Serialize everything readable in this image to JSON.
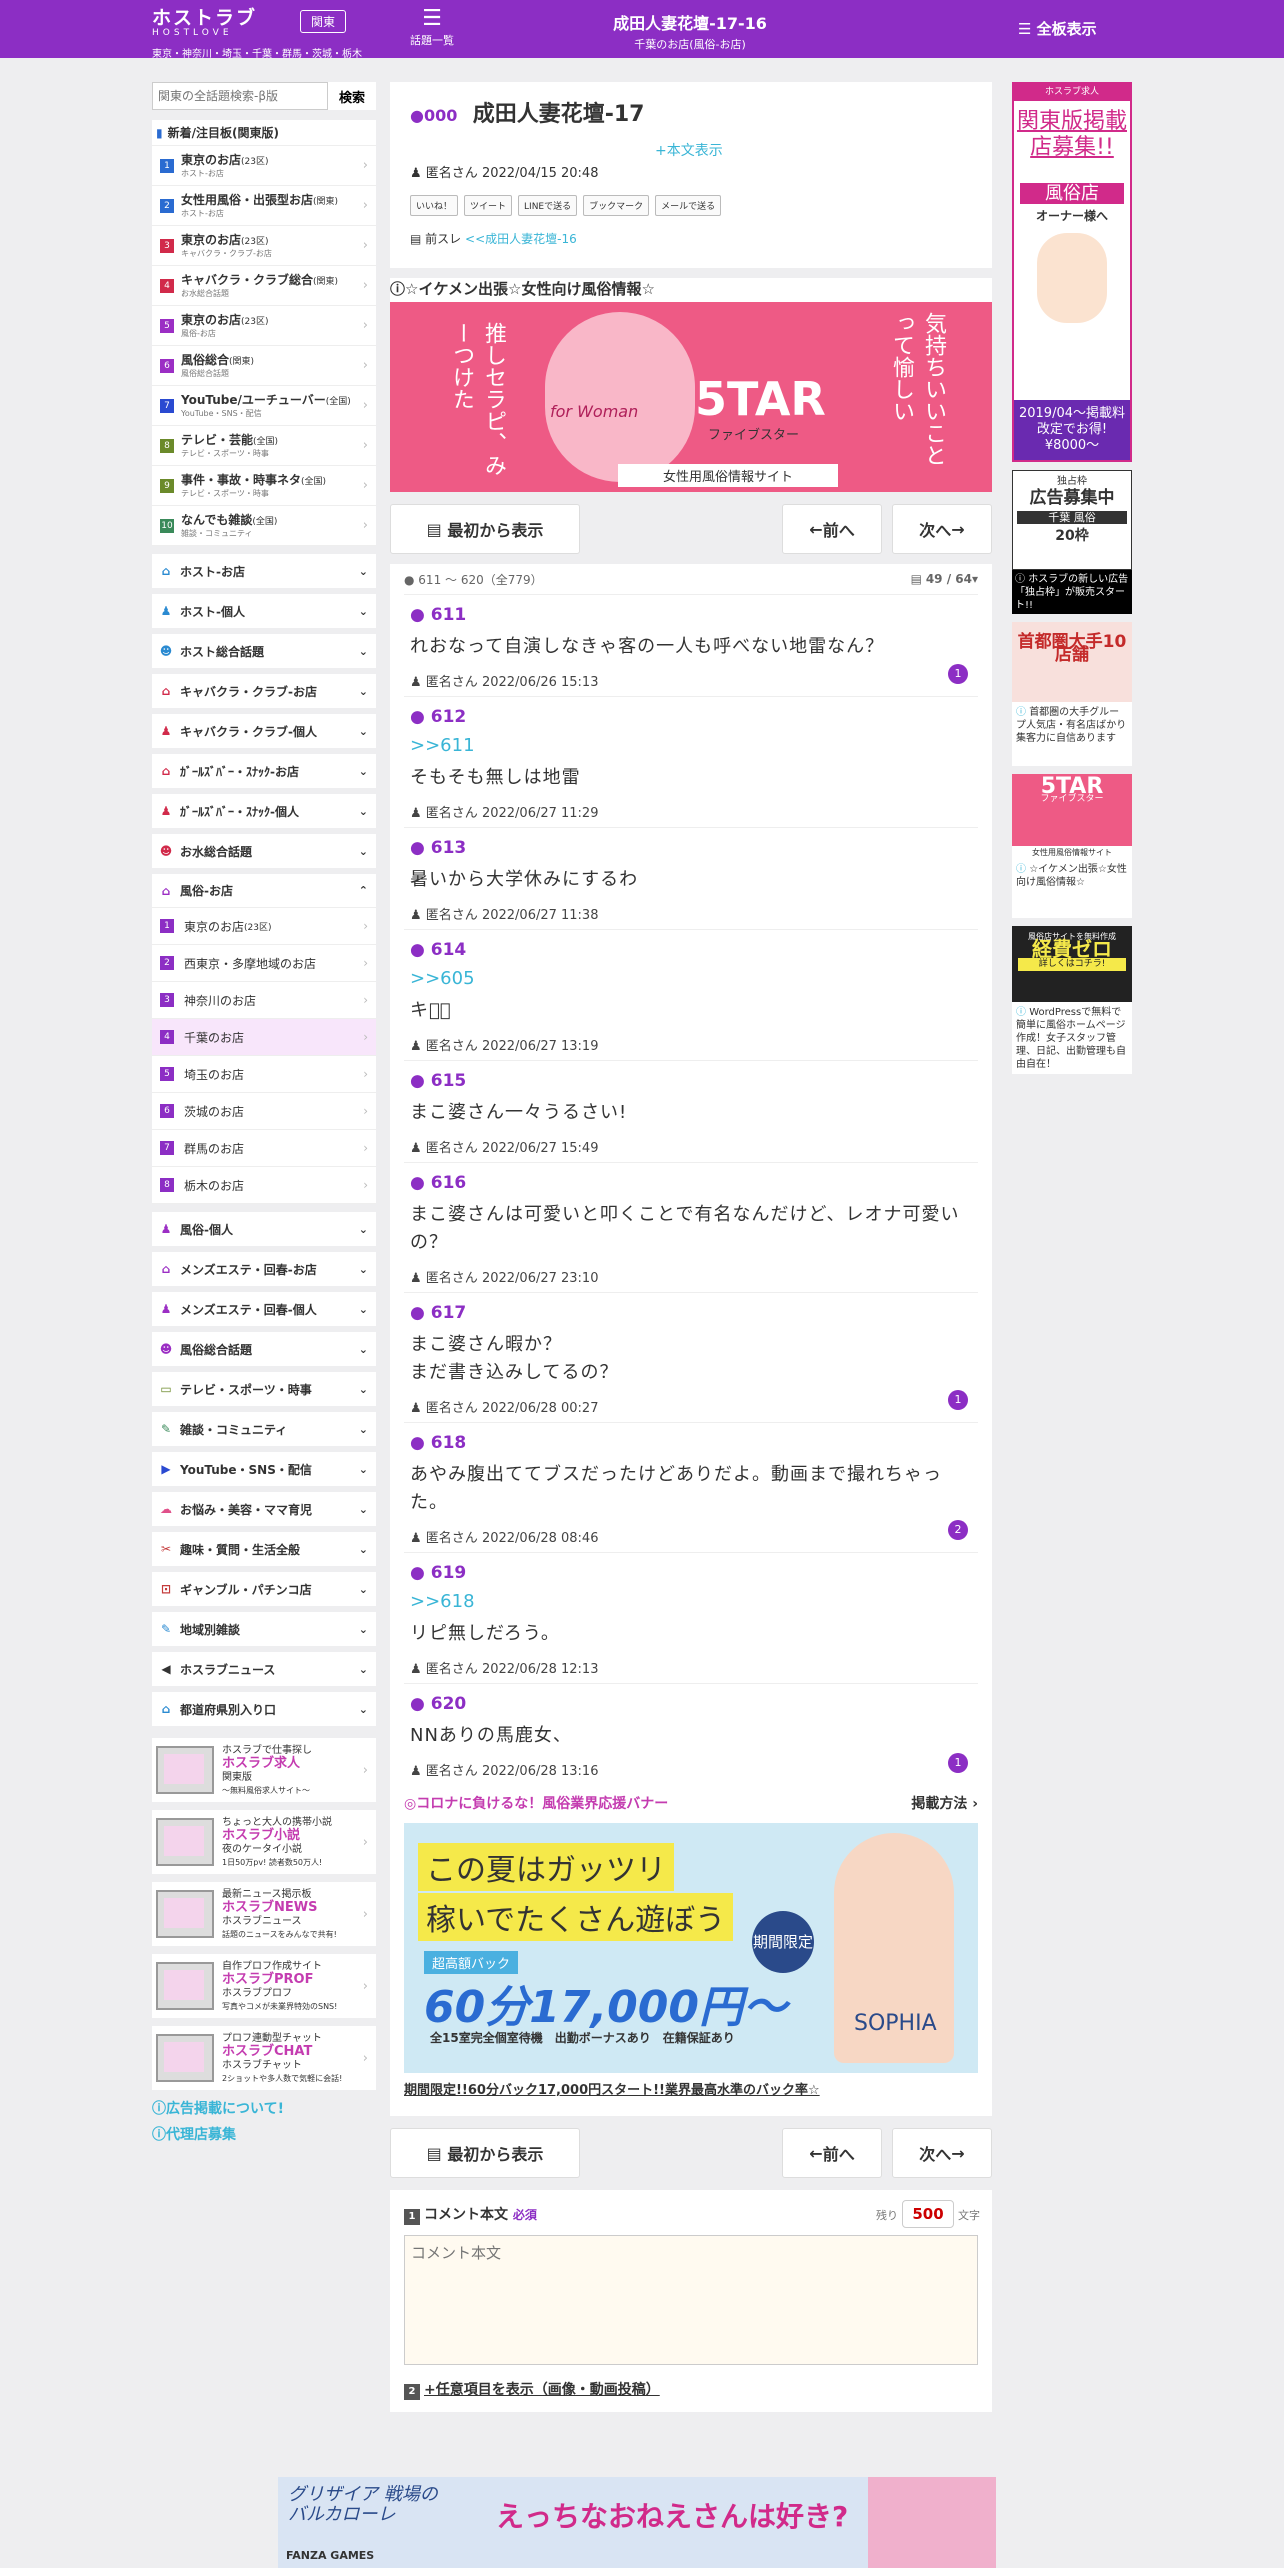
{
  "header": {
    "logo_main": "ホストラブ",
    "logo_sub": "HOSTLOVE",
    "logo_regions": "東京・神奈川・埼玉・千葉・群馬・茨城・栃木",
    "region_button": "関東",
    "topics_label": "話題一覧",
    "title": "成田人妻花壇-17-16",
    "subtitle": "千葉のお店(風俗-お店)",
    "all_board": "全板表示"
  },
  "search": {
    "placeholder": "関東の全話題検索-β版",
    "button": "検索"
  },
  "ranking": {
    "title": "新着/注目板(関東版)",
    "items": [
      {
        "num": "1",
        "label": "東京のお店",
        "note": "(23区)",
        "sub": "ホスト-お店",
        "color": "#2a6bd1"
      },
      {
        "num": "2",
        "label": "女性用風俗・出張型お店",
        "note": "(関東)",
        "sub": "ホスト-お店",
        "color": "#2a6bd1"
      },
      {
        "num": "3",
        "label": "東京のお店",
        "note": "(23区)",
        "sub": "キャバクラ・クラブ-お店",
        "color": "#d12a4a"
      },
      {
        "num": "4",
        "label": "キャバクラ・クラブ総合",
        "note": "(関東)",
        "sub": "お水総合話題",
        "color": "#d12a4a"
      },
      {
        "num": "5",
        "label": "東京のお店",
        "note": "(23区)",
        "sub": "風俗-お店",
        "color": "#9b2ec4"
      },
      {
        "num": "6",
        "label": "風俗総合",
        "note": "(関東)",
        "sub": "風俗総合話題",
        "color": "#9b2ec4"
      },
      {
        "num": "7",
        "label": "YouTube/ユーチューバー",
        "note": "(全国)",
        "sub": "YouTube・SNS・配信",
        "color": "#2a4ad1"
      },
      {
        "num": "8",
        "label": "テレビ・芸能",
        "note": "(全国)",
        "sub": "テレビ・スポーツ・時事",
        "color": "#6b8a2a"
      },
      {
        "num": "9",
        "label": "事件・事故・時事ネタ",
        "note": "(全国)",
        "sub": "テレビ・スポーツ・時事",
        "color": "#6b8a2a"
      },
      {
        "num": "10",
        "label": "なんでも雑談",
        "note": "(全国)",
        "sub": "雑談・コミュニティ",
        "color": "#3a8a5a"
      }
    ]
  },
  "categories_top": [
    {
      "label": "ホスト-お店",
      "icon": "⌂",
      "color": "#2a8ad1"
    },
    {
      "label": "ホスト-個人",
      "icon": "♟",
      "color": "#2a8ad1"
    },
    {
      "label": "ホスト総合話題",
      "icon": "☻",
      "color": "#2a8ad1"
    },
    {
      "label": "キャバクラ・クラブ-お店",
      "icon": "⌂",
      "color": "#d12a4a"
    },
    {
      "label": "キャバクラ・クラブ-個人",
      "icon": "♟",
      "color": "#d12a4a"
    },
    {
      "label": "ｶﾞｰﾙｽﾞﾊﾞｰ・ｽﾅｯｸ-お店",
      "icon": "⌂",
      "color": "#d12a4a"
    },
    {
      "label": "ｶﾞｰﾙｽﾞﾊﾞｰ・ｽﾅｯｸ-個人",
      "icon": "♟",
      "color": "#d12a4a"
    },
    {
      "label": "お水総合話題",
      "icon": "☻",
      "color": "#d12a4a"
    }
  ],
  "fuzoku_open": {
    "label": "風俗-お店",
    "items": [
      {
        "num": "1",
        "label": "東京のお店",
        "note": "(23区)"
      },
      {
        "num": "2",
        "label": "西東京・多摩地域のお店",
        "note": ""
      },
      {
        "num": "3",
        "label": "神奈川のお店",
        "note": ""
      },
      {
        "num": "4",
        "label": "千葉のお店",
        "note": ""
      },
      {
        "num": "5",
        "label": "埼玉のお店",
        "note": ""
      },
      {
        "num": "6",
        "label": "茨城のお店",
        "note": ""
      },
      {
        "num": "7",
        "label": "群馬のお店",
        "note": ""
      },
      {
        "num": "8",
        "label": "栃木のお店",
        "note": ""
      }
    ]
  },
  "categories_bottom": [
    {
      "label": "風俗-個人",
      "icon": "♟",
      "color": "#9b2ec4"
    },
    {
      "label": "メンズエステ・回春-お店",
      "icon": "⌂",
      "color": "#9b2ec4"
    },
    {
      "label": "メンズエステ・回春-個人",
      "icon": "♟",
      "color": "#9b2ec4"
    },
    {
      "label": "風俗総合話題",
      "icon": "☻",
      "color": "#9b2ec4"
    },
    {
      "label": "テレビ・スポーツ・時事",
      "icon": "▭",
      "color": "#6b8a2a"
    },
    {
      "label": "雑談・コミュニティ",
      "icon": "✎",
      "color": "#3a8a5a"
    },
    {
      "label": "YouTube・SNS・配信",
      "icon": "▶",
      "color": "#2a4ad1"
    },
    {
      "label": "お悩み・美容・ママ育児",
      "icon": "☁",
      "color": "#e0508a"
    },
    {
      "label": "趣味・質問・生活全般",
      "icon": "✂",
      "color": "#c43c3c"
    },
    {
      "label": "ギャンブル・パチンコ店",
      "icon": "⊡",
      "color": "#c43c3c"
    },
    {
      "label": "地域別雑談",
      "icon": "✎",
      "color": "#2a8ad1"
    },
    {
      "label": "ホスラブニュース",
      "icon": "◀",
      "color": "#333333"
    },
    {
      "label": "都道府県別入り口",
      "icon": "⌂",
      "color": "#2a8ad1"
    }
  ],
  "side_ads": [
    {
      "small": "ホスラブで仕事探し",
      "brand": "ホスラブ求人",
      "note1": "関東版",
      "note2": "〜無料風俗求人サイト〜"
    },
    {
      "small": "ちょっと大人の携帯小説",
      "brand": "ホスラブ小説",
      "note1": "夜のケータイ小説",
      "note2": "1日50万pv! 読者数50万人!"
    },
    {
      "small": "最新ニュース掲示板",
      "brand": "ホスラブNEWS",
      "note1": "ホスラブニュース",
      "note2": "話題のニュースをみんなで共有!"
    },
    {
      "small": "自作プロフ作成サイト",
      "brand": "ホスラブPROF",
      "note1": "ホスラブプロフ",
      "note2": "写真やコメが未業界特効のSNS!"
    },
    {
      "small": "プロフ連動型チャット",
      "brand": "ホスラブCHAT",
      "note1": "ホスラブチャット",
      "note2": "2ショットや多人数で気軽に会話!"
    }
  ],
  "footer_links": [
    "広告掲載について!",
    "代理店募集"
  ],
  "thread": {
    "number": "000",
    "title": "成田人妻花壇-17",
    "show_body": "+本文表示",
    "author": "匿名さん",
    "date": "2022/04/15 20:48",
    "share": [
      "いいね！",
      "ツイート",
      "LINEで送る",
      "ブックマーク",
      "メールで送る"
    ],
    "prev_label": "前スレ",
    "prev_link": "<<成田人妻花壇-16"
  },
  "banner": {
    "heading": "☆イケメン出張☆女性向け風俗情報☆",
    "left_text": "推しセラピ、みーつけた",
    "right_text": "気持ちいいことって愉しい",
    "for_text": "for Woman",
    "brand": "5TAR",
    "brand_sub": "ファイブスター",
    "caption": "女性用風俗情報サイト"
  },
  "nav": {
    "first": "最初から表示",
    "prev": "前へ",
    "next": "次へ"
  },
  "posts_header": {
    "range": "611 ～ 620（全779）",
    "page": "49 / 64"
  },
  "posts": [
    {
      "num": "611",
      "ref": "",
      "body": "れおなって自演しなきゃ客の一人も呼べない地雷なん？",
      "author": "匿名さん",
      "date": "2022/06/26 15:13",
      "badge": "1"
    },
    {
      "num": "612",
      "ref": ">>611",
      "body": "そもそも無しは地雷",
      "author": "匿名さん",
      "date": "2022/06/27 11:29",
      "badge": ""
    },
    {
      "num": "613",
      "ref": "",
      "body": "暑いから大学休みにするわ",
      "author": "匿名さん",
      "date": "2022/06/27 11:38",
      "badge": ""
    },
    {
      "num": "614",
      "ref": ">>605",
      "body": "キモ⃣",
      "author": "匿名さん",
      "date": "2022/06/27 13:19",
      "badge": ""
    },
    {
      "num": "615",
      "ref": "",
      "body": "まこ婆さん一々うるさい!",
      "author": "匿名さん",
      "date": "2022/06/27 15:49",
      "badge": ""
    },
    {
      "num": "616",
      "ref": "",
      "body": "まこ婆さんは可愛いと叩くことで有名なんだけど、レオナ可愛いの？",
      "author": "匿名さん",
      "date": "2022/06/27 23:10",
      "badge": ""
    },
    {
      "num": "617",
      "ref": "",
      "body": "まこ婆さん暇か？\nまだ書き込みしてるの？",
      "author": "匿名さん",
      "date": "2022/06/28 00:27",
      "badge": "1"
    },
    {
      "num": "618",
      "ref": "",
      "body": "あやみ腹出ててブスだったけどありだよ。動画まで撮れちゃった。",
      "author": "匿名さん",
      "date": "2022/06/28 08:46",
      "badge": "2"
    },
    {
      "num": "619",
      "ref": ">>618",
      "body": "リピ無しだろう。",
      "author": "匿名さん",
      "date": "2022/06/28 12:13",
      "badge": ""
    },
    {
      "num": "620",
      "ref": "",
      "body": "NNありの馬鹿女、",
      "author": "匿名さん",
      "date": "2022/06/28 13:16",
      "badge": "1"
    }
  ],
  "promo": {
    "heading": "◎コロナに負けるな！風俗業界応援バナー",
    "method": "掲載方法",
    "line1": "この夏はガッツリ",
    "line2": "稼いでたくさん遊ぼう",
    "pack_label": "超高額バック",
    "pack": "60分17,000円〜",
    "limit": "期間限定",
    "footer": "全15室完全個室待機　出勤ボーナスあり　在籍保証あり",
    "shop": "SOPHIA",
    "caption": "期間限定!!60分バック17,000円スタート!!業界最高水準のバック率☆"
  },
  "form": {
    "num1": "1",
    "label": "コメント本文",
    "required": "必須",
    "remain_label": "残り",
    "remain": "500",
    "unit": "文字",
    "placeholder": "コメント本文",
    "num2": "2",
    "option": "+任意項目を表示（画像・動画投稿）"
  },
  "right_ads": [
    {
      "title": "関東版掲載店募集!!",
      "sub1": "風俗店",
      "sub2": "オーナー様へ",
      "sub3": "2019/04〜掲載料改定でお得!¥8000〜",
      "caption": ""
    },
    {
      "title": "広告募集中",
      "sub1": "独占枠",
      "sub2": "千葉 風俗",
      "sub3": "20枠",
      "caption": "ホスラブの新しい広告「独占枠」が販売スタート!!"
    },
    {
      "title": "首都圏大手10店舗",
      "sub1": "",
      "sub2": "",
      "sub3": "",
      "caption": "首都圏の大手グループ人気店・有名店ばかり 集客力に自信あります"
    },
    {
      "title": "5TAR",
      "sub1": "ファイブスター",
      "sub2": "女性用風俗情報サイト",
      "sub3": "",
      "caption": "☆イケメン出張☆女性向け風俗情報☆"
    },
    {
      "title": "経費ゼロ",
      "sub1": "風俗店サイトを無料作成",
      "sub2": "詳しくはコチラ!",
      "sub3": "",
      "caption": "WordPressで無料で簡単に風俗ホームページ作成！女子スタッフ管理、日記、出勤管理も自由自在！"
    }
  ],
  "bottom_ad": {
    "left": "グリザイア 戦場のバルカローレ",
    "right": "えっちなおねえさんは好き?",
    "maker": "FANZA GAMES"
  },
  "colors": {
    "brand": "#8c2ec4",
    "link": "#39b5d6"
  }
}
